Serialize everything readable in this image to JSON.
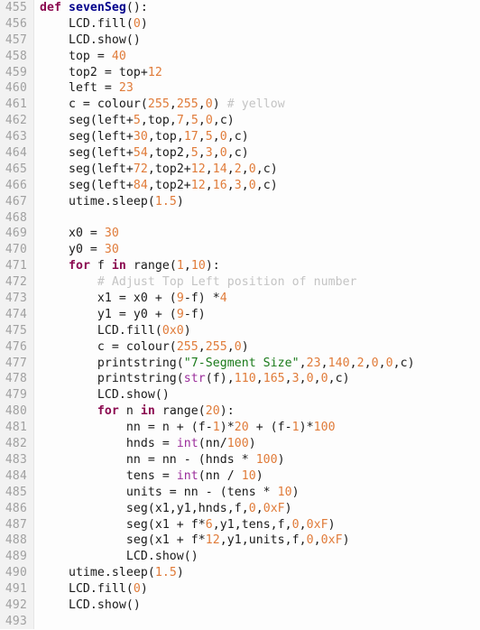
{
  "editor": {
    "language": "python",
    "first_line_number": 455,
    "colors": {
      "background": "#fdfdfd",
      "gutter_background": "#f2f2f2",
      "line_number": "#a0a0a0",
      "plain_text": "#1a1a1a",
      "keyword": "#8b0a50",
      "definition_name": "#00008b",
      "number": "#e07b39",
      "string": "#1a7a1a",
      "comment": "#c4c4c4",
      "builtin": "#9b2d9b"
    }
  },
  "lines": [
    {
      "n": "455",
      "tokens": [
        {
          "t": "def",
          "c": "kw"
        },
        {
          "t": " ",
          "c": "pln"
        },
        {
          "t": "sevenSeg",
          "c": "def"
        },
        {
          "t": "():",
          "c": "pln"
        }
      ]
    },
    {
      "n": "456",
      "tokens": [
        {
          "t": "    LCD.fill(",
          "c": "pln"
        },
        {
          "t": "0",
          "c": "num"
        },
        {
          "t": ")",
          "c": "pln"
        }
      ]
    },
    {
      "n": "457",
      "tokens": [
        {
          "t": "    LCD.show()",
          "c": "pln"
        }
      ]
    },
    {
      "n": "458",
      "tokens": [
        {
          "t": "    top = ",
          "c": "pln"
        },
        {
          "t": "40",
          "c": "num"
        }
      ]
    },
    {
      "n": "459",
      "tokens": [
        {
          "t": "    top2 = top+",
          "c": "pln"
        },
        {
          "t": "12",
          "c": "num"
        }
      ]
    },
    {
      "n": "460",
      "tokens": [
        {
          "t": "    left = ",
          "c": "pln"
        },
        {
          "t": "23",
          "c": "num"
        }
      ]
    },
    {
      "n": "461",
      "tokens": [
        {
          "t": "    c = colour(",
          "c": "pln"
        },
        {
          "t": "255",
          "c": "num"
        },
        {
          "t": ",",
          "c": "pln"
        },
        {
          "t": "255",
          "c": "num"
        },
        {
          "t": ",",
          "c": "pln"
        },
        {
          "t": "0",
          "c": "num"
        },
        {
          "t": ") ",
          "c": "pln"
        },
        {
          "t": "# yellow",
          "c": "com"
        }
      ]
    },
    {
      "n": "462",
      "tokens": [
        {
          "t": "    seg(left+",
          "c": "pln"
        },
        {
          "t": "5",
          "c": "num"
        },
        {
          "t": ",top,",
          "c": "pln"
        },
        {
          "t": "7",
          "c": "num"
        },
        {
          "t": ",",
          "c": "pln"
        },
        {
          "t": "5",
          "c": "num"
        },
        {
          "t": ",",
          "c": "pln"
        },
        {
          "t": "0",
          "c": "num"
        },
        {
          "t": ",c)",
          "c": "pln"
        }
      ]
    },
    {
      "n": "463",
      "tokens": [
        {
          "t": "    seg(left+",
          "c": "pln"
        },
        {
          "t": "30",
          "c": "num"
        },
        {
          "t": ",top,",
          "c": "pln"
        },
        {
          "t": "17",
          "c": "num"
        },
        {
          "t": ",",
          "c": "pln"
        },
        {
          "t": "5",
          "c": "num"
        },
        {
          "t": ",",
          "c": "pln"
        },
        {
          "t": "0",
          "c": "num"
        },
        {
          "t": ",c)",
          "c": "pln"
        }
      ]
    },
    {
      "n": "464",
      "tokens": [
        {
          "t": "    seg(left+",
          "c": "pln"
        },
        {
          "t": "54",
          "c": "num"
        },
        {
          "t": ",top2,",
          "c": "pln"
        },
        {
          "t": "5",
          "c": "num"
        },
        {
          "t": ",",
          "c": "pln"
        },
        {
          "t": "3",
          "c": "num"
        },
        {
          "t": ",",
          "c": "pln"
        },
        {
          "t": "0",
          "c": "num"
        },
        {
          "t": ",c)",
          "c": "pln"
        }
      ]
    },
    {
      "n": "465",
      "tokens": [
        {
          "t": "    seg(left+",
          "c": "pln"
        },
        {
          "t": "72",
          "c": "num"
        },
        {
          "t": ",top2+",
          "c": "pln"
        },
        {
          "t": "12",
          "c": "num"
        },
        {
          "t": ",",
          "c": "pln"
        },
        {
          "t": "14",
          "c": "num"
        },
        {
          "t": ",",
          "c": "pln"
        },
        {
          "t": "2",
          "c": "num"
        },
        {
          "t": ",",
          "c": "pln"
        },
        {
          "t": "0",
          "c": "num"
        },
        {
          "t": ",c)",
          "c": "pln"
        }
      ]
    },
    {
      "n": "466",
      "tokens": [
        {
          "t": "    seg(left+",
          "c": "pln"
        },
        {
          "t": "84",
          "c": "num"
        },
        {
          "t": ",top2+",
          "c": "pln"
        },
        {
          "t": "12",
          "c": "num"
        },
        {
          "t": ",",
          "c": "pln"
        },
        {
          "t": "16",
          "c": "num"
        },
        {
          "t": ",",
          "c": "pln"
        },
        {
          "t": "3",
          "c": "num"
        },
        {
          "t": ",",
          "c": "pln"
        },
        {
          "t": "0",
          "c": "num"
        },
        {
          "t": ",c)",
          "c": "pln"
        }
      ]
    },
    {
      "n": "467",
      "tokens": [
        {
          "t": "    utime.sleep(",
          "c": "pln"
        },
        {
          "t": "1.5",
          "c": "num"
        },
        {
          "t": ")",
          "c": "pln"
        }
      ]
    },
    {
      "n": "468",
      "tokens": []
    },
    {
      "n": "469",
      "tokens": [
        {
          "t": "    x0 = ",
          "c": "pln"
        },
        {
          "t": "30",
          "c": "num"
        }
      ]
    },
    {
      "n": "470",
      "tokens": [
        {
          "t": "    y0 = ",
          "c": "pln"
        },
        {
          "t": "30",
          "c": "num"
        }
      ]
    },
    {
      "n": "471",
      "tokens": [
        {
          "t": "    ",
          "c": "pln"
        },
        {
          "t": "for",
          "c": "kw"
        },
        {
          "t": " f ",
          "c": "pln"
        },
        {
          "t": "in",
          "c": "kw"
        },
        {
          "t": " range(",
          "c": "pln"
        },
        {
          "t": "1",
          "c": "num"
        },
        {
          "t": ",",
          "c": "pln"
        },
        {
          "t": "10",
          "c": "num"
        },
        {
          "t": "):",
          "c": "pln"
        }
      ]
    },
    {
      "n": "472",
      "tokens": [
        {
          "t": "        ",
          "c": "pln"
        },
        {
          "t": "# Adjust Top Left position of number",
          "c": "com"
        }
      ]
    },
    {
      "n": "473",
      "tokens": [
        {
          "t": "        x1 = x0 + (",
          "c": "pln"
        },
        {
          "t": "9",
          "c": "num"
        },
        {
          "t": "-f) *",
          "c": "pln"
        },
        {
          "t": "4",
          "c": "num"
        }
      ]
    },
    {
      "n": "474",
      "tokens": [
        {
          "t": "        y1 = y0 + (",
          "c": "pln"
        },
        {
          "t": "9",
          "c": "num"
        },
        {
          "t": "-f)",
          "c": "pln"
        }
      ]
    },
    {
      "n": "475",
      "tokens": [
        {
          "t": "        LCD.fill(",
          "c": "pln"
        },
        {
          "t": "0x0",
          "c": "num"
        },
        {
          "t": ")",
          "c": "pln"
        }
      ]
    },
    {
      "n": "476",
      "tokens": [
        {
          "t": "        c = colour(",
          "c": "pln"
        },
        {
          "t": "255",
          "c": "num"
        },
        {
          "t": ",",
          "c": "pln"
        },
        {
          "t": "255",
          "c": "num"
        },
        {
          "t": ",",
          "c": "pln"
        },
        {
          "t": "0",
          "c": "num"
        },
        {
          "t": ")",
          "c": "pln"
        }
      ]
    },
    {
      "n": "477",
      "tokens": [
        {
          "t": "        printstring(",
          "c": "pln"
        },
        {
          "t": "\"7-Segment Size\"",
          "c": "str"
        },
        {
          "t": ",",
          "c": "pln"
        },
        {
          "t": "23",
          "c": "num"
        },
        {
          "t": ",",
          "c": "pln"
        },
        {
          "t": "140",
          "c": "num"
        },
        {
          "t": ",",
          "c": "pln"
        },
        {
          "t": "2",
          "c": "num"
        },
        {
          "t": ",",
          "c": "pln"
        },
        {
          "t": "0",
          "c": "num"
        },
        {
          "t": ",",
          "c": "pln"
        },
        {
          "t": "0",
          "c": "num"
        },
        {
          "t": ",c)",
          "c": "pln"
        }
      ]
    },
    {
      "n": "478",
      "tokens": [
        {
          "t": "        printstring(",
          "c": "pln"
        },
        {
          "t": "str",
          "c": "bi"
        },
        {
          "t": "(f),",
          "c": "pln"
        },
        {
          "t": "110",
          "c": "num"
        },
        {
          "t": ",",
          "c": "pln"
        },
        {
          "t": "165",
          "c": "num"
        },
        {
          "t": ",",
          "c": "pln"
        },
        {
          "t": "3",
          "c": "num"
        },
        {
          "t": ",",
          "c": "pln"
        },
        {
          "t": "0",
          "c": "num"
        },
        {
          "t": ",",
          "c": "pln"
        },
        {
          "t": "0",
          "c": "num"
        },
        {
          "t": ",c)",
          "c": "pln"
        }
      ]
    },
    {
      "n": "479",
      "tokens": [
        {
          "t": "        LCD.show()",
          "c": "pln"
        }
      ]
    },
    {
      "n": "480",
      "tokens": [
        {
          "t": "        ",
          "c": "pln"
        },
        {
          "t": "for",
          "c": "kw"
        },
        {
          "t": " n ",
          "c": "pln"
        },
        {
          "t": "in",
          "c": "kw"
        },
        {
          "t": " range(",
          "c": "pln"
        },
        {
          "t": "20",
          "c": "num"
        },
        {
          "t": "):",
          "c": "pln"
        }
      ]
    },
    {
      "n": "481",
      "tokens": [
        {
          "t": "            nn = n + (f-",
          "c": "pln"
        },
        {
          "t": "1",
          "c": "num"
        },
        {
          "t": ")*",
          "c": "pln"
        },
        {
          "t": "20",
          "c": "num"
        },
        {
          "t": " + (f-",
          "c": "pln"
        },
        {
          "t": "1",
          "c": "num"
        },
        {
          "t": ")*",
          "c": "pln"
        },
        {
          "t": "100",
          "c": "num"
        }
      ]
    },
    {
      "n": "482",
      "tokens": [
        {
          "t": "            hnds = ",
          "c": "pln"
        },
        {
          "t": "int",
          "c": "bi"
        },
        {
          "t": "(nn/",
          "c": "pln"
        },
        {
          "t": "100",
          "c": "num"
        },
        {
          "t": ")",
          "c": "pln"
        }
      ]
    },
    {
      "n": "483",
      "tokens": [
        {
          "t": "            nn = nn - (hnds * ",
          "c": "pln"
        },
        {
          "t": "100",
          "c": "num"
        },
        {
          "t": ")",
          "c": "pln"
        }
      ]
    },
    {
      "n": "484",
      "tokens": [
        {
          "t": "            tens = ",
          "c": "pln"
        },
        {
          "t": "int",
          "c": "bi"
        },
        {
          "t": "(nn / ",
          "c": "pln"
        },
        {
          "t": "10",
          "c": "num"
        },
        {
          "t": ")",
          "c": "pln"
        }
      ]
    },
    {
      "n": "485",
      "tokens": [
        {
          "t": "            units = nn - (tens * ",
          "c": "pln"
        },
        {
          "t": "10",
          "c": "num"
        },
        {
          "t": ")",
          "c": "pln"
        }
      ]
    },
    {
      "n": "486",
      "tokens": [
        {
          "t": "            seg(x1,y1,hnds,f,",
          "c": "pln"
        },
        {
          "t": "0",
          "c": "num"
        },
        {
          "t": ",",
          "c": "pln"
        },
        {
          "t": "0xF",
          "c": "num"
        },
        {
          "t": ")",
          "c": "pln"
        }
      ]
    },
    {
      "n": "487",
      "tokens": [
        {
          "t": "            seg(x1 + f*",
          "c": "pln"
        },
        {
          "t": "6",
          "c": "num"
        },
        {
          "t": ",y1,tens,f,",
          "c": "pln"
        },
        {
          "t": "0",
          "c": "num"
        },
        {
          "t": ",",
          "c": "pln"
        },
        {
          "t": "0xF",
          "c": "num"
        },
        {
          "t": ")",
          "c": "pln"
        }
      ]
    },
    {
      "n": "488",
      "tokens": [
        {
          "t": "            seg(x1 + f*",
          "c": "pln"
        },
        {
          "t": "12",
          "c": "num"
        },
        {
          "t": ",y1,units,f,",
          "c": "pln"
        },
        {
          "t": "0",
          "c": "num"
        },
        {
          "t": ",",
          "c": "pln"
        },
        {
          "t": "0xF",
          "c": "num"
        },
        {
          "t": ")",
          "c": "pln"
        }
      ]
    },
    {
      "n": "489",
      "tokens": [
        {
          "t": "            LCD.show()",
          "c": "pln"
        }
      ]
    },
    {
      "n": "490",
      "tokens": [
        {
          "t": "    utime.sleep(",
          "c": "pln"
        },
        {
          "t": "1.5",
          "c": "num"
        },
        {
          "t": ")",
          "c": "pln"
        }
      ]
    },
    {
      "n": "491",
      "tokens": [
        {
          "t": "    LCD.fill(",
          "c": "pln"
        },
        {
          "t": "0",
          "c": "num"
        },
        {
          "t": ")",
          "c": "pln"
        }
      ]
    },
    {
      "n": "492",
      "tokens": [
        {
          "t": "    LCD.show()",
          "c": "pln"
        }
      ]
    },
    {
      "n": "493",
      "tokens": []
    }
  ]
}
